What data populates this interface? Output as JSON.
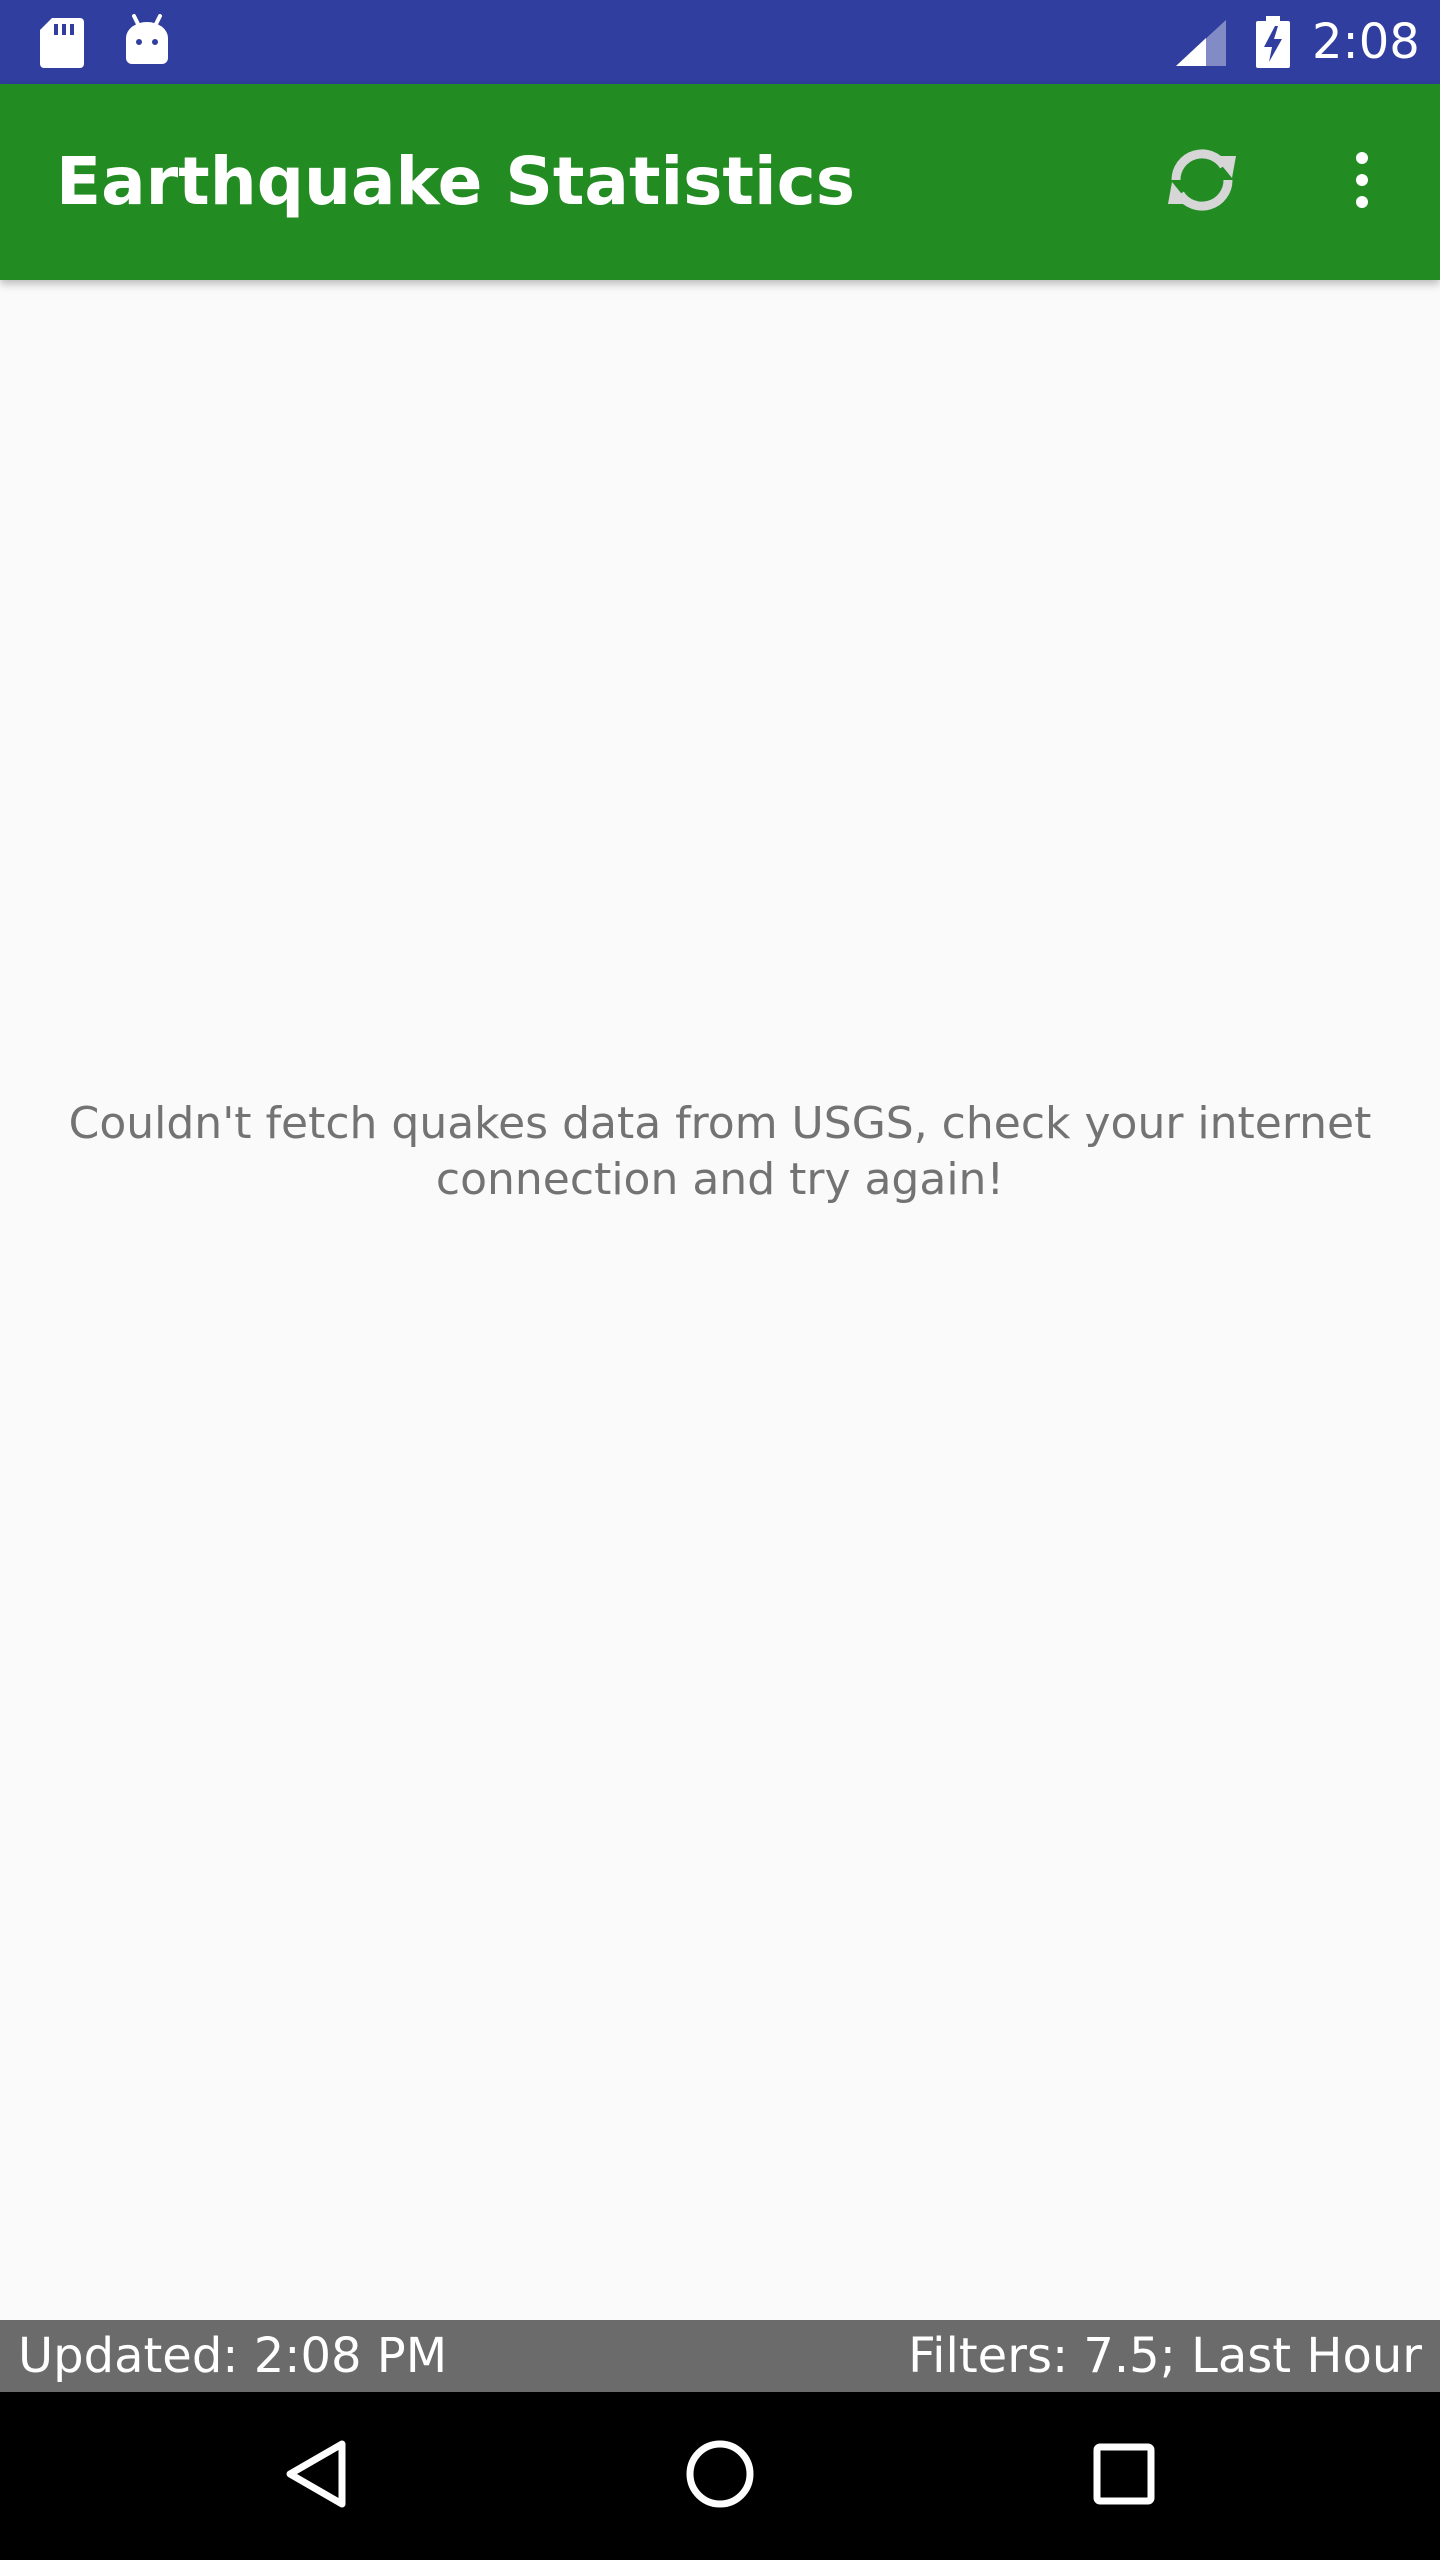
{
  "status_bar": {
    "time": "2:08",
    "icons": [
      "sd-card-icon",
      "android-debug-icon",
      "signal-icon",
      "battery-charging-icon"
    ]
  },
  "app_bar": {
    "title": "Earthquake Statistics",
    "background_color": "#228b22",
    "actions": [
      "refresh-icon",
      "more-vert-icon"
    ]
  },
  "main": {
    "message": "Couldn't fetch quakes data from USGS, check your internet connection and try again!"
  },
  "footer": {
    "updated": "Updated: 2:08 PM",
    "filters": "Filters: 7.5; Last Hour"
  },
  "nav_bar": {
    "icons": [
      "back-icon",
      "home-icon",
      "recents-icon"
    ]
  },
  "colors": {
    "status_bar": "#303f9f",
    "app_bar": "#228b22",
    "footer": "#6b6b6b",
    "message_text": "#737373"
  }
}
